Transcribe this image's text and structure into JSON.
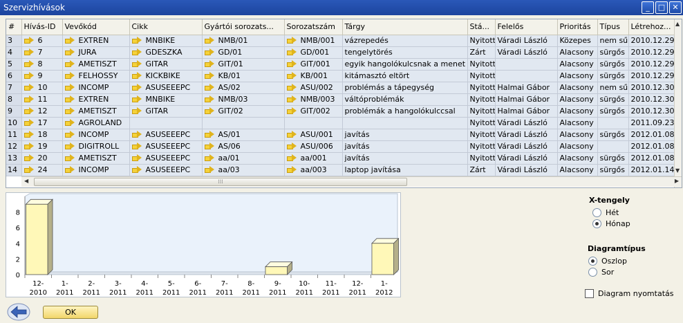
{
  "window": {
    "title": "Szervizhívások",
    "controls": [
      "minimize-icon",
      "maximize-icon",
      "close-icon"
    ]
  },
  "grid": {
    "columns": [
      "#",
      "Hívás-ID",
      "Vevőkód",
      "Cikk",
      "Gyártói sorozats...",
      "Sorozatszám",
      "Tárgy",
      "Stá...",
      "Felelős",
      "Prioritás",
      "Típus",
      "Létrehoz..."
    ],
    "rows": [
      [
        "3",
        "6",
        "EXTREN",
        "MNBIKE",
        "NMB/01",
        "NMB/001",
        "vázrepedés",
        "Nyitott",
        "Váradi László",
        "Közepes",
        "nem sű",
        "2010.12.29"
      ],
      [
        "4",
        "7",
        "JURA",
        "GDESZKA",
        "GD/01",
        "GD/001",
        "tengelytörés",
        "Zárt",
        "Váradi László",
        "Alacsony",
        "sürgős",
        "2010.12.29"
      ],
      [
        "5",
        "8",
        "AMETISZT",
        "GITAR",
        "GIT/01",
        "GIT/001",
        "egyik hangolókulcsnak a menet",
        "Nyitott",
        "",
        "Alacsony",
        "sürgős",
        "2010.12.29"
      ],
      [
        "6",
        "9",
        "FELHOSSY",
        "KICKBIKE",
        "KB/01",
        "KB/001",
        "kitámasztó eltört",
        "Nyitott",
        "",
        "Alacsony",
        "sürgős",
        "2010.12.29"
      ],
      [
        "7",
        "10",
        "INCOMP",
        "ASUSEEEPC",
        "AS/02",
        "ASU/002",
        "problémás a tápegység",
        "Nyitott",
        "Halmai Gábor",
        "Alacsony",
        "nem sű",
        "2010.12.30"
      ],
      [
        "8",
        "11",
        "EXTREN",
        "MNBIKE",
        "NMB/03",
        "NMB/003",
        "váltóproblémák",
        "Nyitott",
        "Halmai Gábor",
        "Alacsony",
        "sürgős",
        "2010.12.30"
      ],
      [
        "9",
        "12",
        "AMETISZT",
        "GITAR",
        "GIT/02",
        "GIT/002",
        "problémák a hangolókulccsal",
        "Nyitott",
        "Halmai Gábor",
        "Alacsony",
        "sürgős",
        "2010.12.30"
      ],
      [
        "10",
        "17",
        "AGROLAND",
        "",
        "",
        "",
        "",
        "Nyitott",
        "Váradi László",
        "Alacsony",
        "",
        "2011.09.23"
      ],
      [
        "11",
        "18",
        "INCOMP",
        "ASUSEEEPC",
        "AS/01",
        "ASU/001",
        "javítás",
        "Nyitott",
        "Váradi László",
        "Alacsony",
        "sürgős",
        "2012.01.08"
      ],
      [
        "12",
        "19",
        "DIGITROLL",
        "ASUSEEEPC",
        "AS/06",
        "ASU/006",
        "javítás",
        "Nyitott",
        "Váradi László",
        "Alacsony",
        "",
        "2012.01.08"
      ],
      [
        "13",
        "20",
        "AMETISZT",
        "ASUSEEEPC",
        "aa/01",
        "aa/001",
        "javítás",
        "Nyitott",
        "Váradi László",
        "Alacsony",
        "sürgős",
        "2012.01.08"
      ],
      [
        "14",
        "24",
        "INCOMP",
        "ASUSEEEPC",
        "aa/03",
        "aa/003",
        "laptop javítása",
        "Zárt",
        "Váradi László",
        "Alacsony",
        "sürgős",
        "2012.01.14"
      ]
    ],
    "link_arrow_icon": "link-arrow-icon",
    "link_arrow_columns": [
      1,
      2,
      3,
      4,
      5
    ]
  },
  "chart_data": {
    "type": "bar",
    "categories": [
      "12-\n2010",
      "1-\n2011",
      "2-\n2011",
      "3-\n2011",
      "4-\n2011",
      "5-\n2011",
      "6-\n2011",
      "7-\n2011",
      "8-\n2011",
      "9-\n2011",
      "10-\n2011",
      "11-\n2011",
      "12-\n2011",
      "1-\n2012"
    ],
    "values": [
      9,
      0,
      0,
      0,
      0,
      0,
      0,
      0,
      0,
      1,
      0,
      0,
      0,
      4
    ],
    "ylim": [
      0,
      10
    ],
    "yticks": [
      0,
      2,
      4,
      6,
      8
    ],
    "bar_color": "#fff8b8",
    "bar_side_color": "#b5b08a",
    "title": "",
    "xlabel": "",
    "ylabel": ""
  },
  "options": {
    "xaxis": {
      "title": "X-tengely",
      "choices": [
        {
          "label": "Hét",
          "selected": false
        },
        {
          "label": "Hónap",
          "selected": true
        }
      ]
    },
    "charttype": {
      "title": "Diagramtípus",
      "choices": [
        {
          "label": "Oszlop",
          "selected": true
        },
        {
          "label": "Sor",
          "selected": false
        }
      ]
    },
    "print": {
      "label": "Diagram nyomtatás",
      "checked": false
    }
  },
  "footer": {
    "back_icon": "back-arrow-icon",
    "ok_label": "OK"
  }
}
